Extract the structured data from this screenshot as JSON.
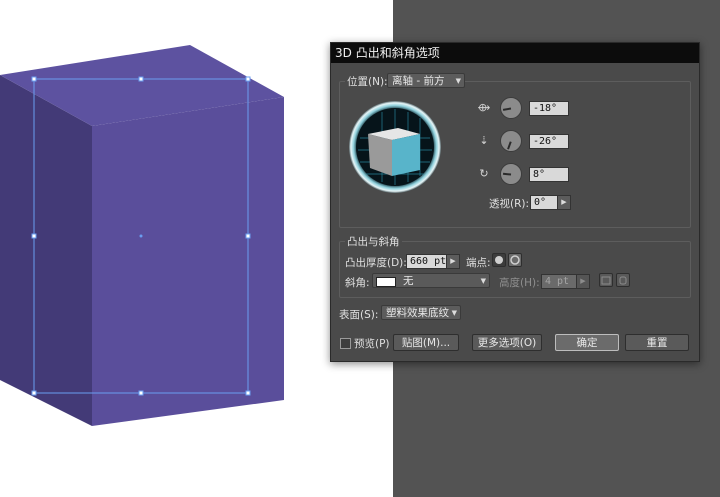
{
  "dialog": {
    "title": "3D 凸出和斜角选项",
    "position": {
      "label": "位置(N):",
      "preset": "离轴 - 前方",
      "x_rotation": "-18°",
      "y_rotation": "-26°",
      "z_rotation": "8°",
      "perspective_label": "透视(R):",
      "perspective_value": "0°"
    },
    "extrude": {
      "group_label": "凸出与斜角",
      "depth_label": "凸出厚度(D):",
      "depth_value": "660 pt",
      "cap_label": "端点:",
      "bevel_label": "斜角:",
      "bevel_value": "无",
      "height_label": "高度(H):",
      "height_value": "4 pt"
    },
    "surface": {
      "label": "表面(S):",
      "value": "塑料效果底纹"
    },
    "buttons": {
      "preview_label": "预览(P)",
      "map_label": "贴图(M)...",
      "more_options_label": "更多选项(O)",
      "ok_label": "确定",
      "reset_label": "重置"
    }
  },
  "colors": {
    "box_front": "#5b4e9c",
    "box_side": "#443a78",
    "box_top": "#5e52a0",
    "selection": "#6a9df0",
    "preview_cube_face": "#5ab6cc"
  },
  "icons": [
    "x-axis-rotate-icon",
    "y-axis-rotate-icon",
    "z-axis-rotate-icon",
    "cap-on-icon",
    "cap-off-icon",
    "bevel-in-icon",
    "bevel-out-icon"
  ]
}
